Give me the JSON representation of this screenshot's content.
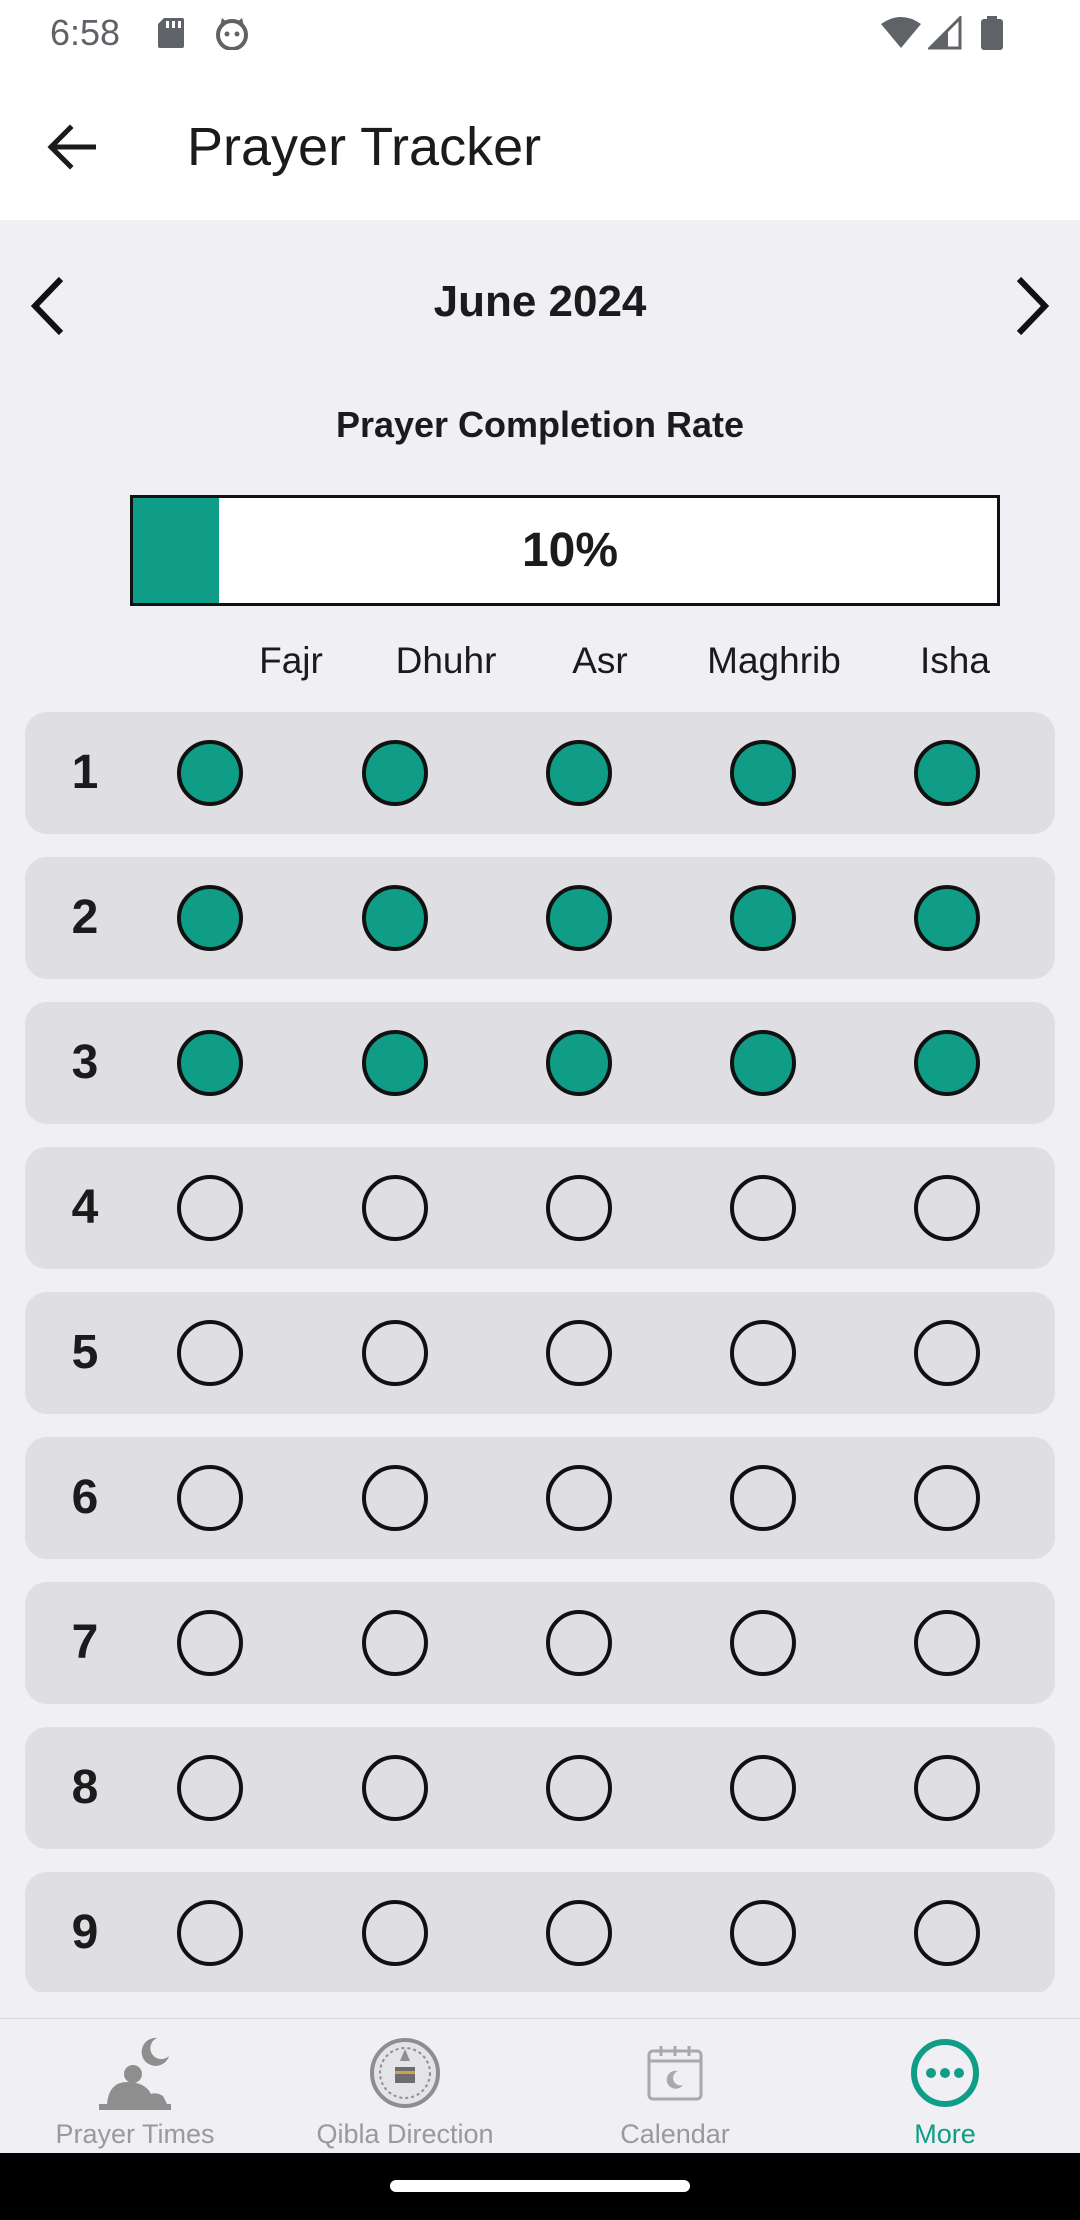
{
  "status_bar": {
    "time": "6:58"
  },
  "app_bar": {
    "title": "Prayer Tracker"
  },
  "month": {
    "label": "June 2024"
  },
  "completion": {
    "title": "Prayer Completion Rate",
    "percent_text": "10%",
    "fraction": 0.1
  },
  "prayers": [
    "Fajr",
    "Dhuhr",
    "Asr",
    "Maghrib",
    "Isha"
  ],
  "days": [
    {
      "day": "1",
      "done": [
        true,
        true,
        true,
        true,
        true
      ]
    },
    {
      "day": "2",
      "done": [
        true,
        true,
        true,
        true,
        true
      ]
    },
    {
      "day": "3",
      "done": [
        true,
        true,
        true,
        true,
        true
      ]
    },
    {
      "day": "4",
      "done": [
        false,
        false,
        false,
        false,
        false
      ]
    },
    {
      "day": "5",
      "done": [
        false,
        false,
        false,
        false,
        false
      ]
    },
    {
      "day": "6",
      "done": [
        false,
        false,
        false,
        false,
        false
      ]
    },
    {
      "day": "7",
      "done": [
        false,
        false,
        false,
        false,
        false
      ]
    },
    {
      "day": "8",
      "done": [
        false,
        false,
        false,
        false,
        false
      ]
    },
    {
      "day": "9",
      "done": [
        false,
        false,
        false,
        false,
        false
      ]
    }
  ],
  "bottom_nav": [
    {
      "label": "Prayer Times",
      "icon": "prayer-times-icon",
      "active": false
    },
    {
      "label": "Qibla Direction",
      "icon": "qibla-compass-icon",
      "active": false
    },
    {
      "label": "Calendar",
      "icon": "calendar-icon",
      "active": false
    },
    {
      "label": "More",
      "icon": "more-icon",
      "active": true
    }
  ],
  "colors": {
    "accent": "#0f9d87",
    "row_bg": "#dfdfe3",
    "page_bg": "#EFEFF4",
    "inactive_nav": "#9a9a9a"
  }
}
